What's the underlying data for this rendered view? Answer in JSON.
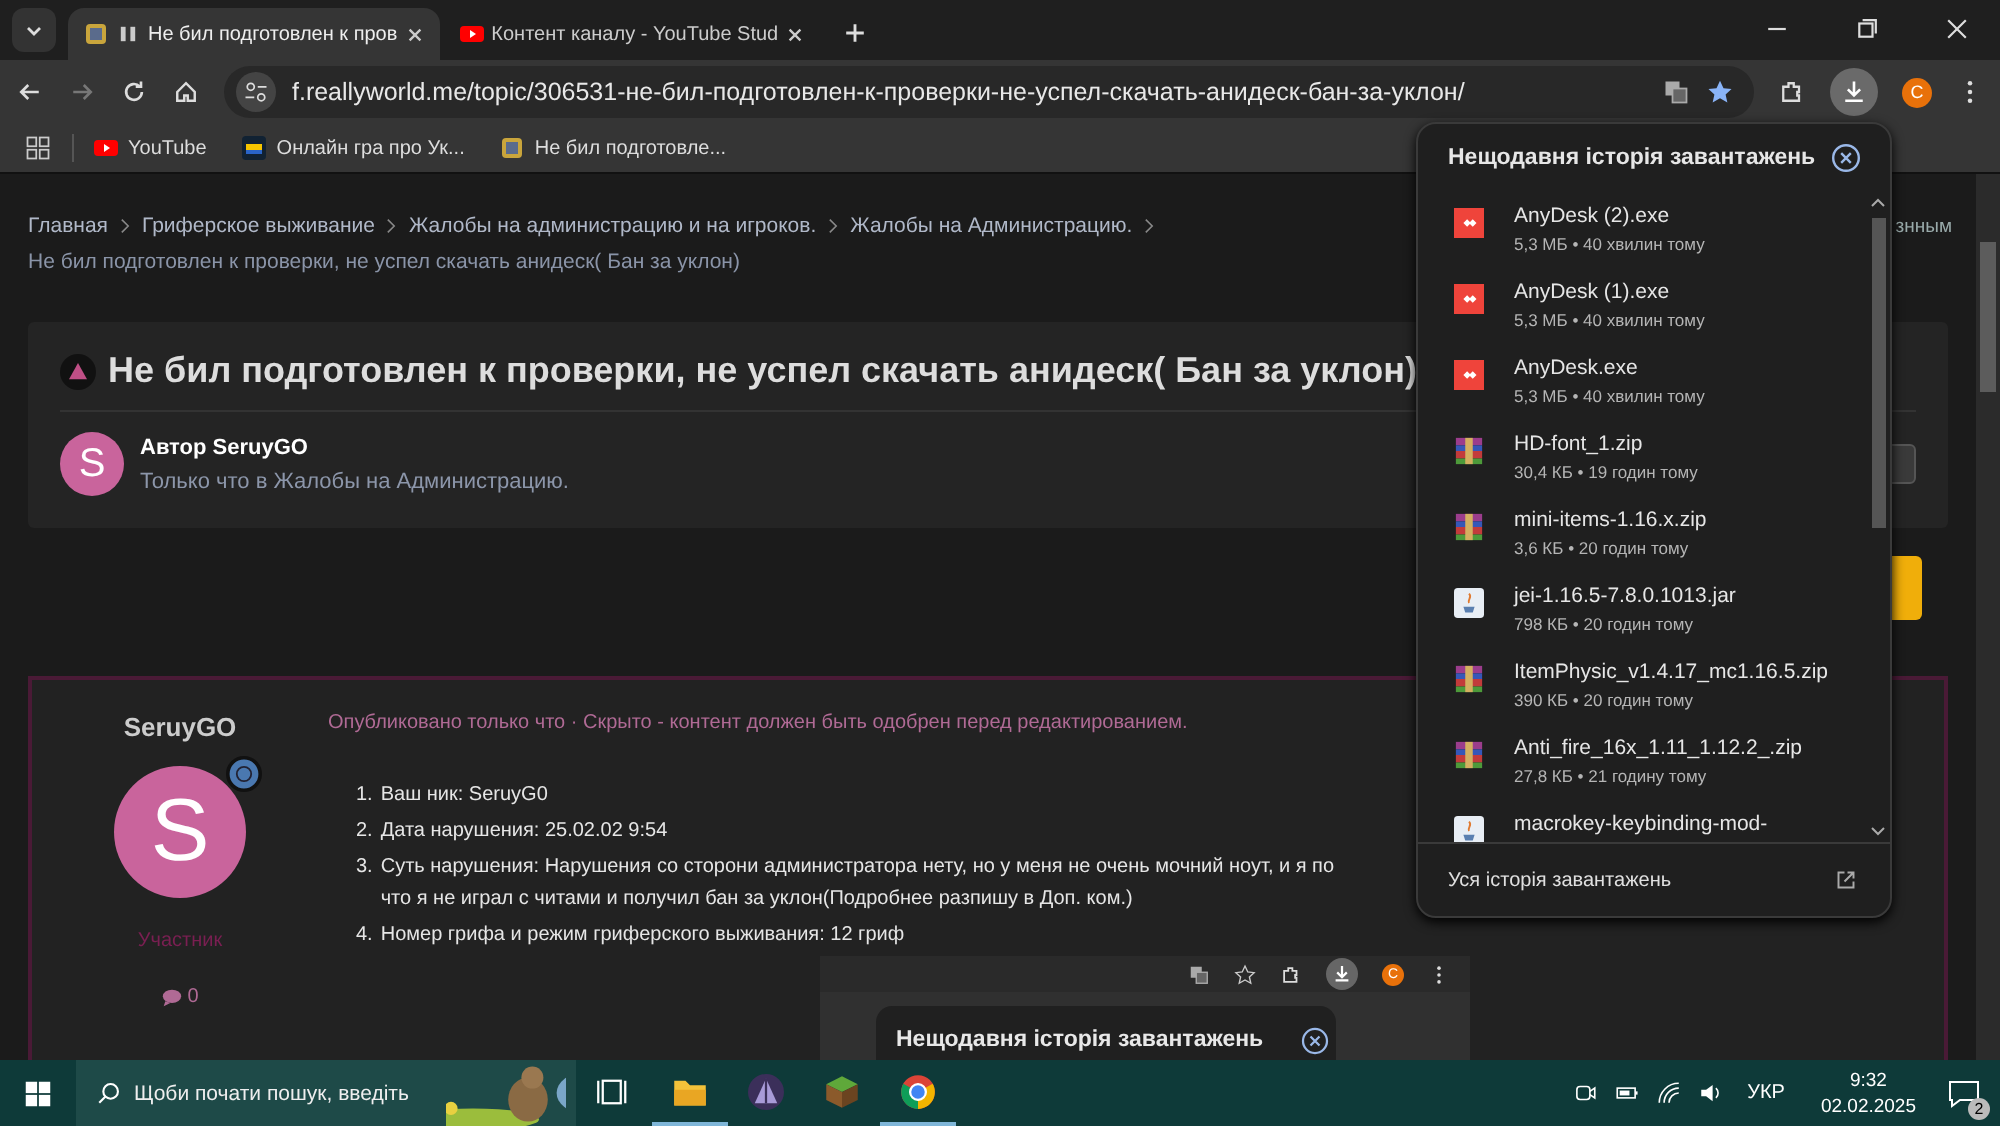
{
  "tabs": [
    {
      "title": "Не бил подготовлен к пров",
      "muted": true,
      "selected": true
    },
    {
      "title": "Контент каналу - YouTube Stud",
      "muted": false,
      "selected": false
    }
  ],
  "toolbar": {
    "url": "f.reallyworld.me/topic/306531-не-бил-подготовлен-к-проверки-не-успел-скачать-анидеск-бан-за-уклон/",
    "profile": "C"
  },
  "bookmarks": [
    {
      "label": "YouTube"
    },
    {
      "label": "Онлайн гра про Ук..."
    },
    {
      "label": "Не бил подготовле..."
    }
  ],
  "page": {
    "breadcrumbs": [
      "Главная",
      "Гриферское выживание",
      "Жалобы на администрацию и на игроков.",
      "Жалобы на Администрацию."
    ],
    "current": "Не бил подготовлен к проверки, не успел скачать анидеск( Бан за уклон)",
    "side_text": "знным",
    "topic": {
      "title": "Не бил подготовлен к проверки, не успел скачать анидеск( Бан за уклон)",
      "avatar": "S",
      "author": "Автор SeruyGO",
      "subtitle": "Только что в Жалобы на Администрацию."
    },
    "post": {
      "author": "SeruyGO",
      "avatar": "S",
      "role": "Участник",
      "comments": "0",
      "meta": "Опубликовано только что · Скрыто - контент должен быть одобрен перед редактированием.",
      "items": [
        {
          "number": "1.",
          "text": "Ваш ник: SeruyG0"
        },
        {
          "number": "2.",
          "text": "Дата нарушения: 25.02.02 9:54"
        },
        {
          "number": "3.",
          "text": "Суть нарушения: Нарушения со сторони администратора нету, но у меня не очень мочний ноут, и я по\nчто я не играл с читами и получил бан за уклон(Подробнее разпишу в Доп. ком.)"
        },
        {
          "number": "4.",
          "text": "Номер грифа и режим гриферского выживания: 12 гриф"
        }
      ],
      "screenshot": {
        "profile": "C",
        "title": "Нещодавня історія завантажень"
      }
    }
  },
  "downloads": {
    "title": "Нещодавня історія завантажень",
    "footer": "Уся історія завантажень",
    "items": [
      {
        "name": "AnyDesk (2).exe",
        "info": "5,3 МБ • 40 хвилин тому",
        "kind": "exe"
      },
      {
        "name": "AnyDesk (1).exe",
        "info": "5,3 МБ • 40 хвилин тому",
        "kind": "exe"
      },
      {
        "name": "AnyDesk.exe",
        "info": "5,3 МБ • 40 хвилин тому",
        "kind": "exe"
      },
      {
        "name": "HD-font_1.zip",
        "info": "30,4 КБ • 19 годин тому",
        "kind": "zip"
      },
      {
        "name": "mini-items-1.16.x.zip",
        "info": "3,6 КБ • 20 годин тому",
        "kind": "zip"
      },
      {
        "name": "jei-1.16.5-7.8.0.1013.jar",
        "info": "798 КБ • 20 годин тому",
        "kind": "jar"
      },
      {
        "name": "ItemPhysic_v1.4.17_mc1.16.5.zip",
        "info": "390 КБ • 20 годин тому",
        "kind": "zip"
      },
      {
        "name": "Anti_fire_16x_1.11_1.12.2_.zip",
        "info": "27,8 КБ • 21 годину тому",
        "kind": "zip"
      },
      {
        "name": "macrokey-keybinding-mod-",
        "kind": "jar"
      }
    ]
  },
  "taskbar": {
    "search_placeholder": "Щоби почати пошук, введіть",
    "apps": [
      {
        "kind": "taskview",
        "selected": false
      },
      {
        "kind": "explorer",
        "selected": true
      },
      {
        "kind": "prism",
        "selected": false
      },
      {
        "kind": "minecraft",
        "selected": false
      },
      {
        "kind": "chrome",
        "selected": true
      }
    ],
    "language": "УКР",
    "time": "9:32",
    "date": "02.02.2025",
    "notifications": "2"
  }
}
